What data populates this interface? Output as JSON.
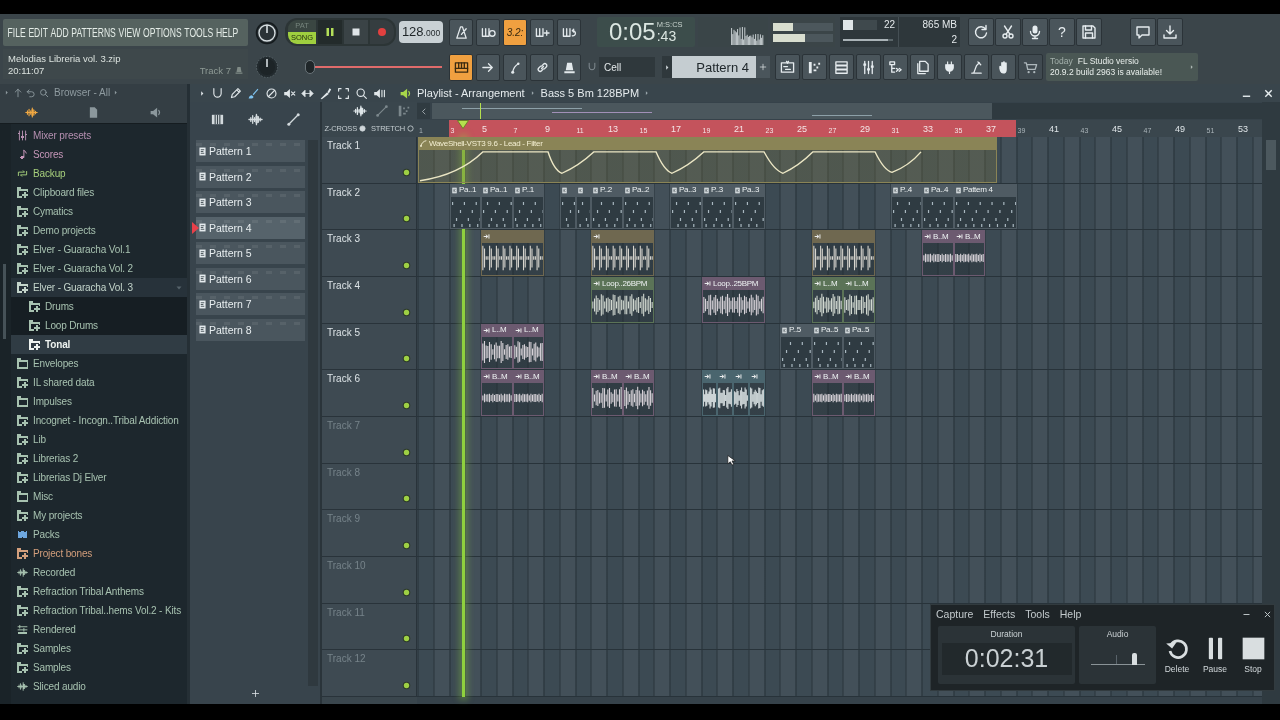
{
  "menu": [
    "FILE",
    "EDIT",
    "ADD",
    "PATTERNS",
    "VIEW",
    "OPTIONS",
    "TOOLS",
    "HELP"
  ],
  "hint_panel": {
    "title": "Melodias Libreria vol. 3.zip",
    "time": "20:11:07",
    "target": "Track 7"
  },
  "transport": {
    "modes": [
      {
        "label": "PAT",
        "selected": false
      },
      {
        "label": "SONG",
        "selected": true
      }
    ],
    "playing": true,
    "tempo": "128.000",
    "song_position": {
      "level": 0.04
    }
  },
  "toggles": {
    "row_1": [
      {
        "kind": "metronome",
        "on": false
      },
      {
        "kind": "wait",
        "on": false
      },
      {
        "kind": "countdown",
        "label": "3.2:",
        "on": true
      },
      {
        "kind": "overdub",
        "on": false
      },
      {
        "kind": "loop",
        "on": false
      }
    ],
    "row_2": [
      {
        "kind": "keyboard",
        "on": true
      },
      {
        "kind": "arrow",
        "on": false
      },
      {
        "kind": "step",
        "on": false
      },
      {
        "kind": "link",
        "on": false
      },
      {
        "kind": "bell",
        "on": false
      }
    ]
  },
  "time_display": {
    "time": "0:05",
    "fraction": ":43",
    "format": "M:S:CS"
  },
  "output_meters": [
    {
      "level": 0.33
    },
    {
      "level": 0.54
    }
  ],
  "performance": {
    "cpu_meter": {
      "level": 0.3
    },
    "cpu": "22",
    "memory": "865 MB",
    "polyphony_meter": {
      "level": 0.9
    },
    "polyphony": "2"
  },
  "toolbar": {
    "help_label": "?"
  },
  "snap": "Cell",
  "pattern_selector": "Pattern 4",
  "news": {
    "date": "Today",
    "lines": [
      "FL Studio versio",
      "20.9.2 build 2963 is available!"
    ]
  },
  "browser": {
    "title": "Browser - All",
    "items": [
      {
        "label": "Mixer presets",
        "kind": "mixer",
        "color": "#b58fb0",
        "expanded": false,
        "selected": false
      },
      {
        "label": "Scores",
        "kind": "note",
        "color": "#c596b8",
        "expanded": false,
        "selected": false
      },
      {
        "label": "Backup",
        "kind": "backup",
        "color": "#a6cf7c",
        "expanded": false,
        "selected": false
      },
      {
        "label": "Clipboard files",
        "kind": "folder-plus",
        "color": "#a7c2b0",
        "expanded": false,
        "selected": false
      },
      {
        "label": "Cymatics",
        "kind": "folder-plus",
        "color": "#a7c2b0",
        "expanded": false,
        "selected": false
      },
      {
        "label": "Demo projects",
        "kind": "folder-plus",
        "color": "#a7c2b0",
        "expanded": false,
        "selected": false
      },
      {
        "label": "Elver - Guaracha Vol.1",
        "kind": "folder-plus",
        "color": "#a7c2b0",
        "expanded": false,
        "selected": false
      },
      {
        "label": "Elver - Guaracha Vol. 2",
        "kind": "folder-plus",
        "color": "#a7c2b0",
        "expanded": false,
        "selected": false
      },
      {
        "label": "Elver - Guaracha Vol. 3",
        "kind": "folder-plus",
        "color": "#c4d5cb",
        "expanded": true,
        "selected": false,
        "children": [
          {
            "label": "Drums",
            "kind": "folder-plus",
            "color": "#a7c2b0",
            "selected": false
          },
          {
            "label": "Loop Drums",
            "kind": "folder-plus",
            "color": "#a7c2b0",
            "selected": false
          },
          {
            "label": "Tonal",
            "kind": "folder-plus",
            "color": "#eef3f0",
            "selected": true
          }
        ]
      },
      {
        "label": "Envelopes",
        "kind": "folder",
        "color": "#a7c2b0",
        "expanded": false,
        "selected": false
      },
      {
        "label": "IL shared data",
        "kind": "folder-plus",
        "color": "#a7c2b0",
        "expanded": false,
        "selected": false
      },
      {
        "label": "Impulses",
        "kind": "folder",
        "color": "#a7c2b0",
        "expanded": false,
        "selected": false
      },
      {
        "label": "Incognet - Incogn..Tribal Addiction",
        "kind": "folder-plus",
        "color": "#a7c2b0",
        "expanded": false,
        "selected": false
      },
      {
        "label": "Lib",
        "kind": "folder-plus",
        "color": "#a7c2b0",
        "expanded": false,
        "selected": false
      },
      {
        "label": "Librerias 2",
        "kind": "folder-plus",
        "color": "#a7c2b0",
        "expanded": false,
        "selected": false
      },
      {
        "label": "Librerias Dj Elver",
        "kind": "folder-plus",
        "color": "#a7c2b0",
        "expanded": false,
        "selected": false
      },
      {
        "label": "Misc",
        "kind": "folder",
        "color": "#a7c2b0",
        "expanded": false,
        "selected": false
      },
      {
        "label": "My projects",
        "kind": "folder-plus",
        "color": "#a7c2b0",
        "expanded": false,
        "selected": false
      },
      {
        "label": "Packs",
        "kind": "packs",
        "color": "#a7c2b0",
        "expanded": false,
        "selected": false
      },
      {
        "label": "Project bones",
        "kind": "folder-plus",
        "color": "#d49f7c",
        "expanded": false,
        "selected": false
      },
      {
        "label": "Recorded",
        "kind": "waveform",
        "color": "#a7c2b0",
        "expanded": false,
        "selected": false
      },
      {
        "label": "Refraction Tribal Anthems",
        "kind": "folder-plus",
        "color": "#a7c2b0",
        "expanded": false,
        "selected": false
      },
      {
        "label": "Refraction Tribal..hems Vol.2 - Kits",
        "kind": "folder-plus",
        "color": "#a7c2b0",
        "expanded": false,
        "selected": false
      },
      {
        "label": "Rendered",
        "kind": "rendered",
        "color": "#a7c2b0",
        "expanded": false,
        "selected": false
      },
      {
        "label": "Samples",
        "kind": "folder-plus",
        "color": "#a7c2b0",
        "expanded": false,
        "selected": false
      },
      {
        "label": "Samples",
        "kind": "folder-plus",
        "color": "#a7c2b0",
        "expanded": false,
        "selected": false
      },
      {
        "label": "Sliced audio",
        "kind": "waveform",
        "color": "#a7c2b0",
        "expanded": false,
        "selected": false
      }
    ]
  },
  "patterns": [
    {
      "label": "Pattern 1",
      "selected": false
    },
    {
      "label": "Pattern 2",
      "selected": false
    },
    {
      "label": "Pattern 3",
      "selected": false
    },
    {
      "label": "Pattern 4",
      "selected": true
    },
    {
      "label": "Pattern 5",
      "selected": false
    },
    {
      "label": "Pattern 6",
      "selected": false
    },
    {
      "label": "Pattern 7",
      "selected": false
    },
    {
      "label": "Pattern 8",
      "selected": false
    }
  ],
  "playlist": {
    "title": "Playlist - Arrangement",
    "breadcrumb": "Bass 5 Bm 128BPM",
    "options": [
      {
        "label": "Z-CROSS",
        "on": true
      },
      {
        "label": "STRETCH",
        "on": false
      }
    ],
    "ruler": [
      "1",
      "3",
      "5",
      "7",
      "9",
      "11",
      "13",
      "15",
      "17",
      "19",
      "21",
      "23",
      "25",
      "27",
      "29",
      "31",
      "33",
      "35",
      "37",
      "39",
      "41",
      "43",
      "45",
      "47",
      "49",
      "51",
      "53"
    ],
    "tracks": [
      {
        "name": "Track 1",
        "clips": [
          {
            "kind": "automation",
            "label": "WaveShell-VST3 9.6 - Lead - Filter",
            "color": "#8a8456"
          }
        ]
      },
      {
        "name": "Track 2",
        "clips": [
          {
            "kind": "pattern",
            "label": "Pa..1",
            "color": "#4f5b63"
          },
          {
            "kind": "pattern",
            "label": "Pa..1",
            "color": "#4f5b63"
          },
          {
            "kind": "pattern",
            "label": "P..1",
            "color": "#4f5b63"
          },
          {
            "kind": "pattern",
            "color": "#4f5b63"
          },
          {
            "kind": "pattern",
            "color": "#4f5b63"
          },
          {
            "kind": "pattern",
            "label": "P..2",
            "color": "#4f5b63"
          },
          {
            "kind": "pattern",
            "label": "Pa..2",
            "color": "#4f5b63"
          },
          {
            "kind": "pattern",
            "label": "Pa..3",
            "color": "#4f5b63"
          },
          {
            "kind": "pattern",
            "label": "P..3",
            "color": "#4f5b63"
          },
          {
            "kind": "pattern",
            "label": "Pa..3",
            "color": "#4f5b63"
          },
          {
            "kind": "pattern",
            "label": "P..4",
            "color": "#4f5b63"
          },
          {
            "kind": "pattern",
            "label": "Pa..4",
            "color": "#4f5b63"
          },
          {
            "kind": "pattern",
            "label": "Pattern 4",
            "color": "#4f5b63"
          }
        ]
      },
      {
        "name": "Track 3",
        "clips": [
          {
            "kind": "audio",
            "color": "#6f6850"
          },
          {
            "kind": "audio",
            "color": "#6f6850"
          },
          {
            "kind": "audio",
            "color": "#6f6850"
          },
          {
            "kind": "audio",
            "label": "B..M",
            "color": "#6c5a70"
          },
          {
            "kind": "audio",
            "label": "B..M",
            "color": "#6c5a70"
          }
        ]
      },
      {
        "name": "Track 4",
        "clips": [
          {
            "kind": "audio",
            "label": "Loop..26BPM",
            "color": "#5b7357"
          },
          {
            "kind": "audio",
            "label": "Loop..25BPM",
            "color": "#6c5a70"
          },
          {
            "kind": "audio",
            "label": "L..M",
            "color": "#5b7357"
          },
          {
            "kind": "audio",
            "label": "L..M",
            "color": "#5b7357"
          }
        ]
      },
      {
        "name": "Track 5",
        "clips": [
          {
            "kind": "audio",
            "label": "L..M",
            "color": "#6c5a70"
          },
          {
            "kind": "audio",
            "label": "L..M",
            "color": "#6c5a70"
          },
          {
            "kind": "pattern",
            "label": "P..5",
            "color": "#4f5b63"
          },
          {
            "kind": "pattern",
            "label": "Pa..5",
            "color": "#4f5b63"
          },
          {
            "kind": "pattern",
            "label": "Pa..5",
            "color": "#4f5b63"
          }
        ]
      },
      {
        "name": "Track 6",
        "clips": [
          {
            "kind": "audio",
            "label": "B..M",
            "color": "#6c5a70"
          },
          {
            "kind": "audio",
            "label": "B..M",
            "color": "#6c5a70"
          },
          {
            "kind": "audio",
            "label": "B..M",
            "color": "#6c5a70"
          },
          {
            "kind": "audio",
            "label": "B..M",
            "color": "#6c5a70"
          },
          {
            "kind": "audio",
            "color": "#4a656e"
          },
          {
            "kind": "audio",
            "color": "#4a656e"
          },
          {
            "kind": "audio",
            "color": "#4a656e"
          },
          {
            "kind": "audio",
            "color": "#4a656e"
          },
          {
            "kind": "audio",
            "label": "B..M",
            "color": "#6c5a70"
          },
          {
            "kind": "audio",
            "label": "B..M",
            "color": "#6c5a70"
          }
        ]
      },
      {
        "name": "Track 7"
      },
      {
        "name": "Track 8"
      },
      {
        "name": "Track 9"
      },
      {
        "name": "Track 10"
      },
      {
        "name": "Track 11"
      },
      {
        "name": "Track 12"
      }
    ]
  },
  "recorder": {
    "menu": [
      "Capture",
      "Effects",
      "Tools",
      "Help"
    ],
    "duration_label": "Duration",
    "duration": "0:02:31",
    "audio_label": "Audio",
    "audio_level": {
      "level": 0.83
    },
    "buttons": [
      {
        "kind": "delete",
        "label": "Delete"
      },
      {
        "kind": "pause",
        "label": "Pause"
      },
      {
        "kind": "stop",
        "label": "Stop"
      }
    ]
  }
}
